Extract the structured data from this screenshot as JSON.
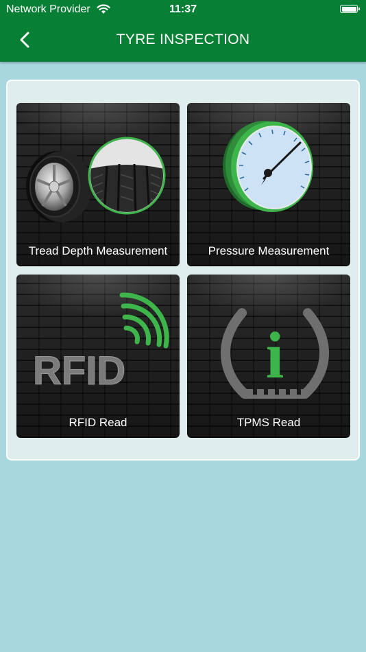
{
  "status_bar": {
    "carrier": "Network Provider",
    "time": "11:37"
  },
  "header": {
    "title": "TYRE INSPECTION"
  },
  "tiles": [
    {
      "label": "Tread Depth Measurement",
      "icon": "tyre-tread-icon"
    },
    {
      "label": "Pressure Measurement",
      "icon": "pressure-gauge-icon"
    },
    {
      "label": "RFID Read",
      "icon": "rfid-icon",
      "icon_text": "RFID"
    },
    {
      "label": "TPMS Read",
      "icon": "tpms-warning-icon",
      "icon_text": "i"
    }
  ],
  "colors": {
    "header_green": "#077f34",
    "accent_green": "#3db54a",
    "background": "#a8d8de",
    "panel": "#dfeded"
  }
}
